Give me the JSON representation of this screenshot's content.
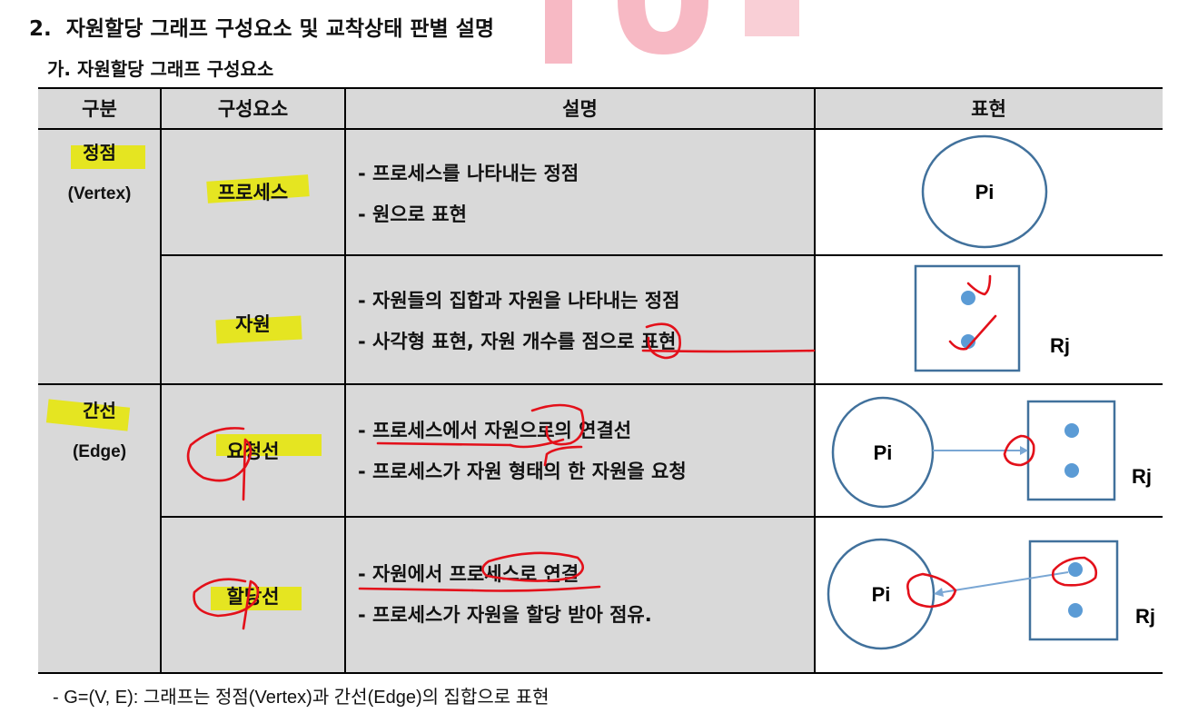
{
  "section": {
    "number": "2.",
    "title": "자원할당 그래프 구성요소 및 교착상태 판별 설명"
  },
  "subsection": {
    "label": "가.",
    "title": "자원할당 그래프 구성요소"
  },
  "table": {
    "headers": [
      "구분",
      "구성요소",
      "설명",
      "표현"
    ],
    "categories": [
      {
        "ko": "정점",
        "en": "(Vertex)"
      },
      {
        "ko": "간선",
        "en": "(Edge)"
      }
    ],
    "rows": [
      {
        "component": "프로세스",
        "lines": [
          "- 프로세스를 나타내는 정점",
          "- 원으로 표현"
        ],
        "figure": {
          "labels": [
            "Pi"
          ]
        }
      },
      {
        "component": "자원",
        "lines": [
          "- 자원들의 집합과 자원을 나타내는 정점",
          "- 사각형 표현, 자원 개수를 점으로 표현"
        ],
        "figure": {
          "labels": [
            "Rj"
          ]
        }
      },
      {
        "component": "요청선",
        "lines": [
          "- 프로세스에서 자원으로의 연결선",
          "- 프로세스가 자원 형태의 한 자원을 요청"
        ],
        "figure": {
          "labels": [
            "Pi",
            "Rj"
          ]
        }
      },
      {
        "component": "할당선",
        "lines": [
          "- 자원에서 프로세스로 연결",
          "- 프로세스가 자원을 할당 받아 점유."
        ],
        "figure": {
          "labels": [
            "Pi",
            "Rj"
          ]
        }
      }
    ]
  },
  "footnote": "- G=(V, E): 그래프는 정점(Vertex)과 간선(Edge)의 집합으로 표현",
  "colors": {
    "header_bg": "#d9d9d9",
    "highlight": "#e6e600",
    "annotation_ink": "#e3101a",
    "figure_stroke": "#41719c",
    "dot_fill": "#5b9bd5",
    "watermark": "#f7b9c4"
  }
}
